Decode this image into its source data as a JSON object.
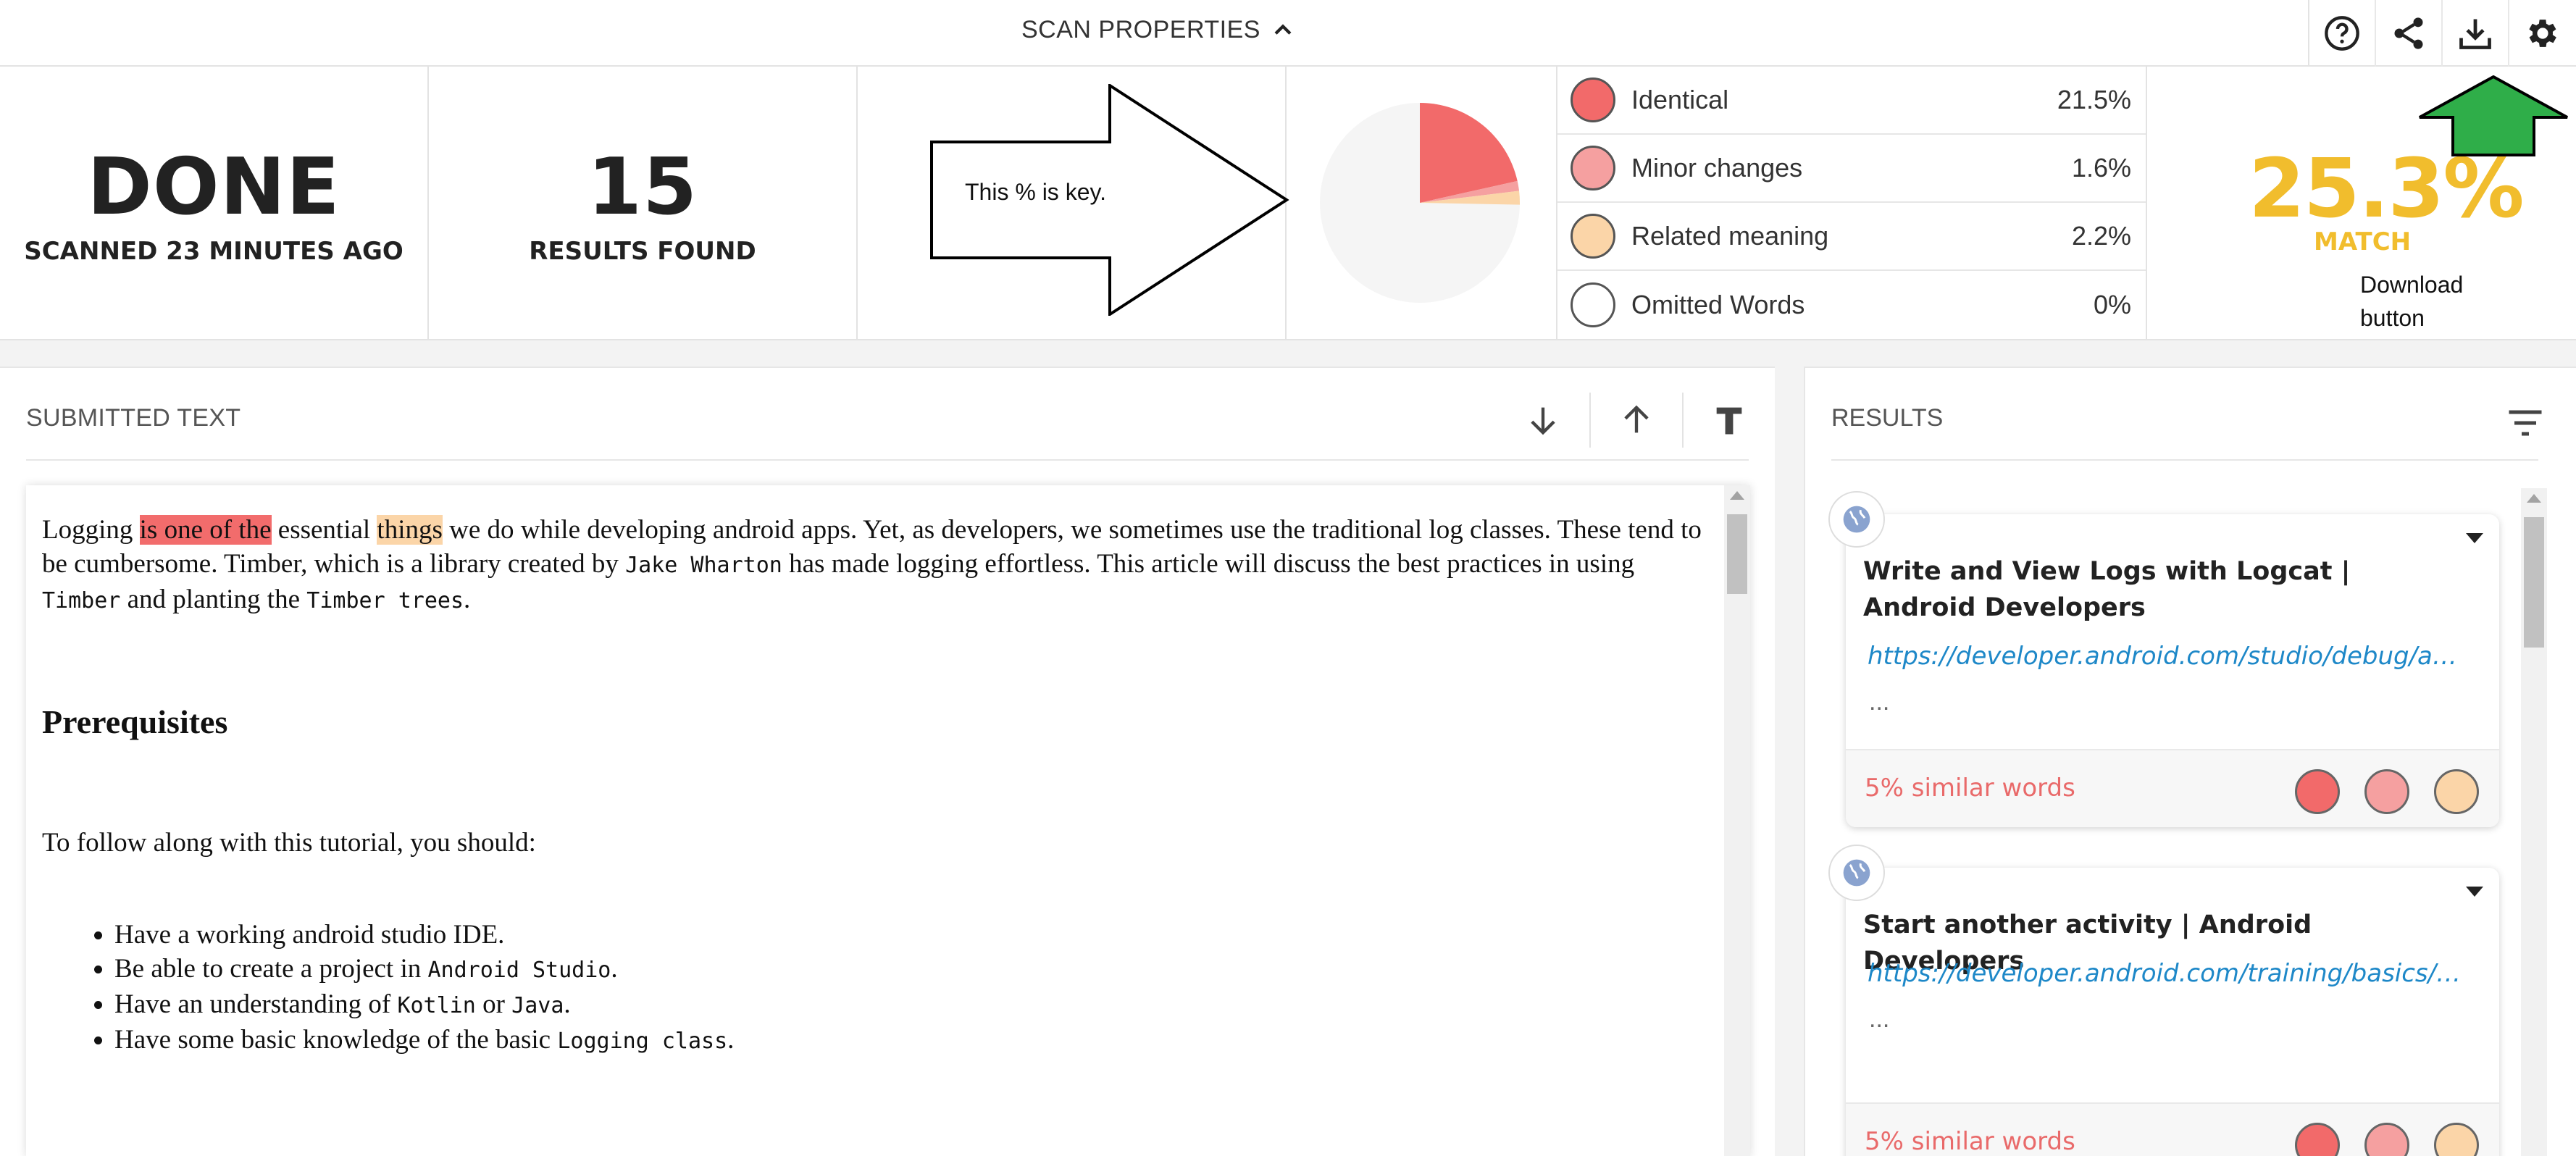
{
  "topbar": {
    "scan_properties_label": "SCAN PROPERTIES",
    "icons": [
      "help-icon",
      "share-icon",
      "download-icon",
      "settings-icon"
    ]
  },
  "summary": {
    "status_word": "DONE",
    "status_sub": "SCANNED 23 MINUTES AGO",
    "results_count": "15",
    "results_sub": "RESULTS FOUND",
    "callout_text": "This % is key.",
    "legend": [
      {
        "label": "Identical",
        "value": "21.5%",
        "color": "#f26a6a"
      },
      {
        "label": "Minor changes",
        "value": "1.6%",
        "color": "#f5a0a0"
      },
      {
        "label": "Related meaning",
        "value": "2.2%",
        "color": "#fbd5a8"
      },
      {
        "label": "Omitted Words",
        "value": "0%",
        "color": "#ffffff"
      }
    ],
    "pie_fractions": {
      "identical": 0.215,
      "minor": 0.016,
      "related": 0.022
    },
    "match_percent": "25.3%",
    "match_label": "MATCH",
    "download_note_line1": "Download",
    "download_note_line2": "button",
    "colors": {
      "match": "#f1bd2d",
      "arrow": "#2fae49"
    }
  },
  "submitted": {
    "title": "SUBMITTED TEXT",
    "para1": {
      "t1": "Logging ",
      "hl_red": "is one of the",
      "t2": " essential ",
      "hl_orange": "things",
      "t3": " we do while developing android apps. Yet, as developers, we sometimes use the traditional log classes. These tend to be cumbersome. Timber, which is a library created by ",
      "code1": "Jake Wharton",
      "t4": " has made logging effortless. This article will discuss the best practices in using ",
      "code2": "Timber",
      "t5": " and planting the ",
      "code3": "Timber trees",
      "t6": "."
    },
    "heading": "Prerequisites",
    "para2": "To follow along with this tutorial, you should:",
    "list": [
      {
        "text": "Have a working android studio IDE.",
        "code": "",
        "text2": "",
        "code2": "",
        "text3": ""
      },
      {
        "text": "Be able to create a project in ",
        "code": "Android Studio",
        "text2": ".",
        "code2": "",
        "text3": ""
      },
      {
        "text": "Have an understanding of ",
        "code": "Kotlin",
        "text2": " or ",
        "code2": "Java",
        "text3": "."
      },
      {
        "text": "Have some basic knowledge of the basic ",
        "code": "Logging class",
        "text2": ".",
        "code2": "",
        "text3": ""
      }
    ]
  },
  "results": {
    "title": "RESULTS",
    "cards": [
      {
        "title": "Write and View Logs with Logcat | Android Developers",
        "url": "https://developer.android.com/studio/debug/am-logcat",
        "ellipsis": "...",
        "similar": "5% similar words"
      },
      {
        "title": "Start another activity | Android Developers",
        "url": "https://developer.android.com/training/basics/firstapp/starting-activity",
        "ellipsis": "...",
        "similar": "5% similar words"
      }
    ]
  }
}
